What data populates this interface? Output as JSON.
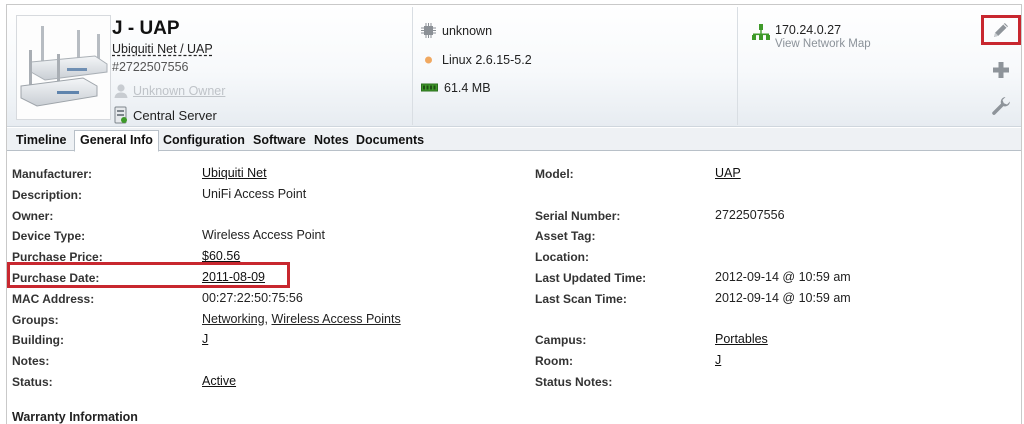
{
  "device": {
    "title": "J - UAP",
    "vendor_model": "Ubiquiti Net / UAP",
    "serial_tag": "#2722507556",
    "owner": "Unknown Owner",
    "server": "Central Server"
  },
  "specs": {
    "cpu": "unknown",
    "os": "Linux 2.6.15-5.2",
    "memory": "61.4 MB"
  },
  "network": {
    "ip": "170.24.0.27",
    "map_link": "View Network Map"
  },
  "tools": [
    "edit-pencil-icon",
    "add-plus-icon",
    "wrench-icon"
  ],
  "tabs": [
    "Timeline",
    "General Info",
    "Configuration",
    "Software",
    "Notes",
    "Documents"
  ],
  "active_tab": "General Info",
  "details_left": [
    {
      "label": "Manufacturer:",
      "value": "Ubiquiti Net",
      "link": true
    },
    {
      "label": "Description:",
      "value": "UniFi Access Point",
      "link": false
    },
    {
      "label": "Owner:",
      "value": "",
      "link": false
    },
    {
      "label": "Device Type:",
      "value": "Wireless Access Point",
      "link": false
    },
    {
      "label": "Purchase Price:",
      "value": "$60.56",
      "link": true
    },
    {
      "label": "Purchase Date:",
      "value": "2011-08-09",
      "link": true
    },
    {
      "label": "MAC Address:",
      "value": "00:27:22:50:75:56",
      "link": false
    },
    {
      "label": "Groups:",
      "links": [
        "Networking",
        "Wireless Access Points"
      ],
      "separator": ", "
    },
    {
      "label": "Building:",
      "value": "J",
      "link": true
    },
    {
      "label": "Notes:",
      "value": "",
      "link": false
    },
    {
      "label": "Status:",
      "value": "Active",
      "link": true
    }
  ],
  "details_right": [
    {
      "label": "Model:",
      "value": "UAP",
      "link": true
    },
    {
      "label": "",
      "value": "",
      "link": false
    },
    {
      "label": "Serial Number:",
      "value": "2722507556",
      "link": false
    },
    {
      "label": "Asset Tag:",
      "value": "",
      "link": false
    },
    {
      "label": "Location:",
      "value": "",
      "link": false
    },
    {
      "label": "Last Updated Time:",
      "value": "2012-09-14 @ 10:59 am",
      "link": false
    },
    {
      "label": "Last Scan Time:",
      "value": "2012-09-14 @ 10:59 am",
      "link": false
    },
    {
      "label": "",
      "value": "",
      "link": false
    },
    {
      "label": "Campus:",
      "value": "Portables",
      "link": true
    },
    {
      "label": "Room:",
      "value": "J",
      "link": true
    },
    {
      "label": "Status Notes:",
      "value": "",
      "link": false
    }
  ],
  "section_heading": "Warranty Information",
  "colors": {
    "highlight": "#c8272f",
    "network_green": "#3f9a2a",
    "tab_border": "#b8c0c8"
  }
}
